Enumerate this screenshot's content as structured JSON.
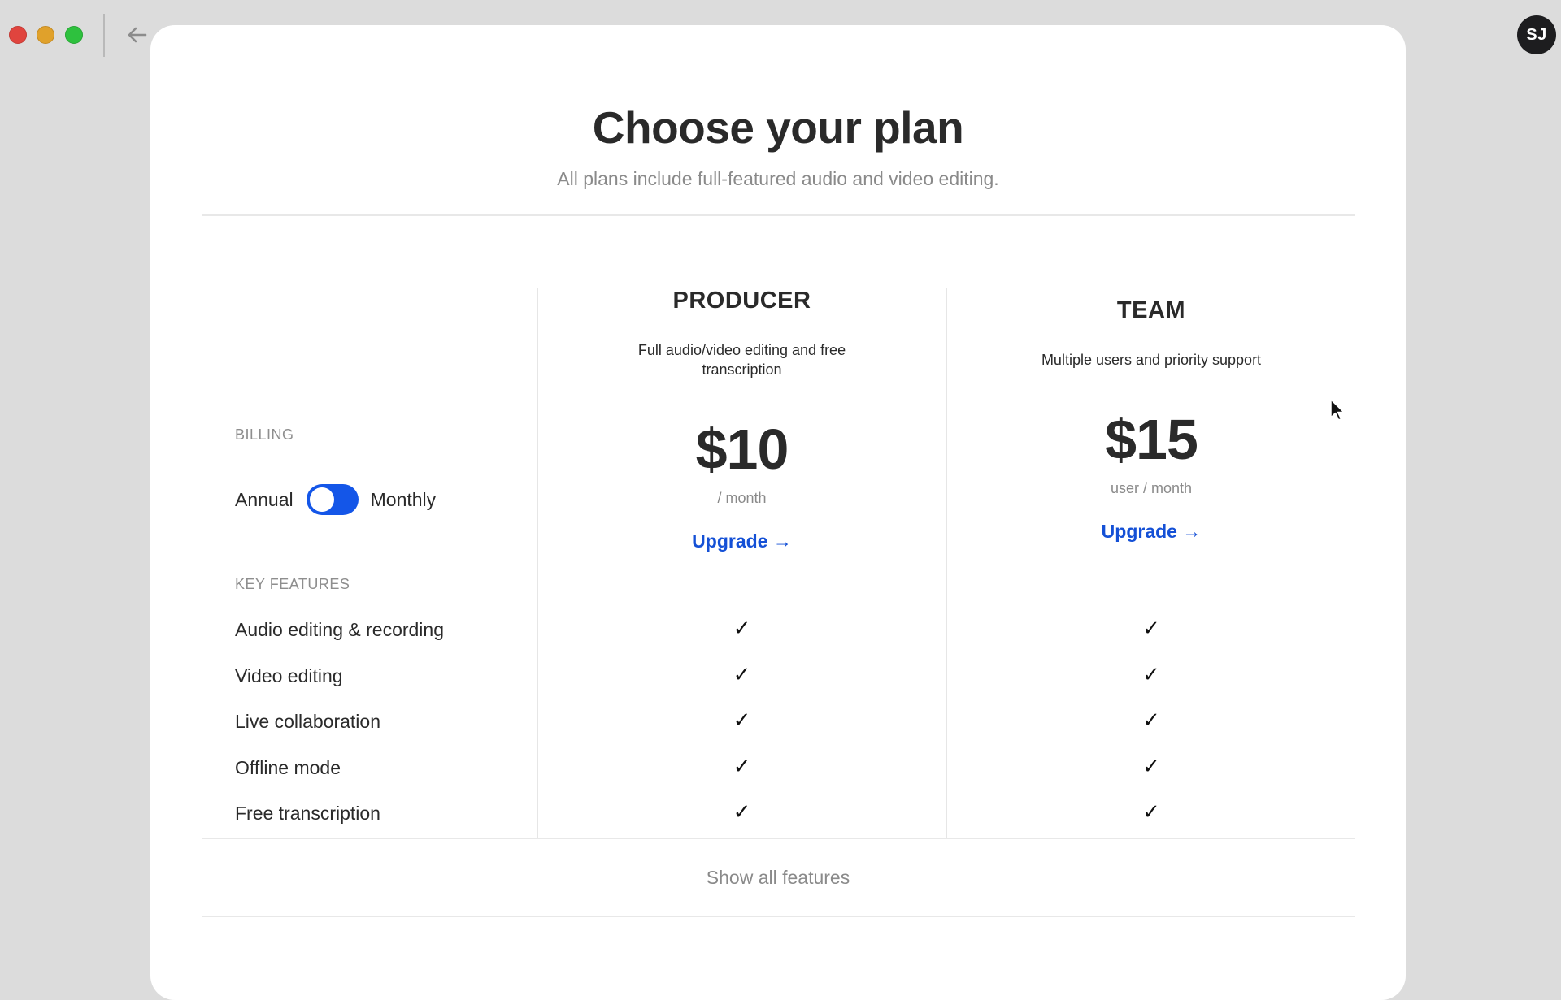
{
  "window": {
    "controls": [
      "close",
      "minimize",
      "maximize"
    ],
    "back_icon": "arrow-left-icon",
    "avatar_initials": "SJ"
  },
  "header": {
    "title": "Choose your plan",
    "subtitle": "All plans include full-featured audio and video editing."
  },
  "billing": {
    "label": "BILLING",
    "option_left": "Annual",
    "option_right": "Monthly",
    "selected": "Annual",
    "toggle_color": "#1456e8"
  },
  "features": {
    "label": "KEY FEATURES",
    "items": [
      "Audio editing & recording",
      "Video editing",
      "Live collaboration",
      "Offline mode",
      "Free transcription"
    ]
  },
  "plans": [
    {
      "name": "PRODUCER",
      "description": "Full audio/video editing and free transcription",
      "price": "$10",
      "period": "/ month",
      "cta": "Upgrade →",
      "features_included": [
        true,
        true,
        true,
        true,
        true
      ]
    },
    {
      "name": "TEAM",
      "description": "Multiple users and priority support",
      "price": "$15",
      "period": "user / month",
      "cta": "Upgrade →",
      "features_included": [
        true,
        true,
        true,
        true,
        true
      ]
    }
  ],
  "check_glyph": "✓",
  "show_all_label": "Show all features",
  "colors": {
    "accent": "#1450d6",
    "background": "#dcdcdc",
    "card": "#ffffff"
  }
}
